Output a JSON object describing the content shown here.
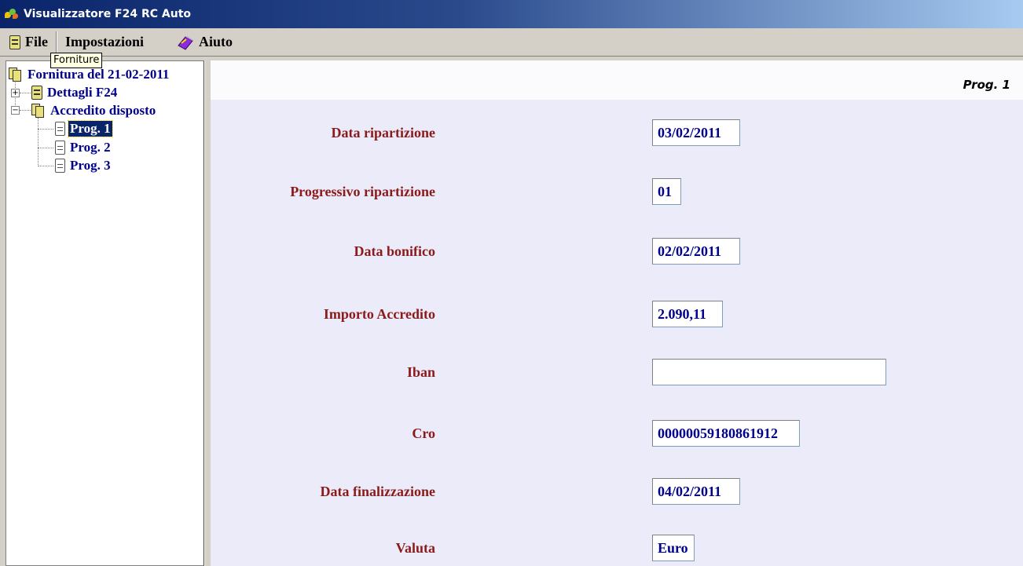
{
  "window": {
    "title": "Visualizzatore F24 RC Auto"
  },
  "menu": {
    "file": "File",
    "impostazioni": "Impostazioni",
    "aiuto": "Aiuto"
  },
  "tooltip": "Forniture",
  "tree": {
    "root": "Fornitura del 21-02-2011",
    "dettagli": "Dettagli F24",
    "accredito": "Accredito disposto",
    "prog1": "Prog. 1",
    "prog2": "Prog. 2",
    "prog3": "Prog. 3"
  },
  "detail": {
    "header": "Prog. 1",
    "fields": [
      {
        "label": "Data ripartizione",
        "value": "03/02/2011"
      },
      {
        "label": "Progressivo ripartizione",
        "value": "01"
      },
      {
        "label": "Data bonifico",
        "value": "02/02/2011"
      },
      {
        "label": "Importo Accredito",
        "value": "2.090,11"
      },
      {
        "label": "Iban",
        "value": ""
      },
      {
        "label": "Cro",
        "value": "00000059180861912"
      },
      {
        "label": "Data finalizzazione",
        "value": "04/02/2011"
      },
      {
        "label": "Valuta",
        "value": "Euro"
      }
    ]
  },
  "icons": {
    "app": "app-icon",
    "file": "database-icon",
    "aiuto": "help-book-icon",
    "tree_root": "document-folder-icon",
    "tree_node": "document-icon"
  }
}
